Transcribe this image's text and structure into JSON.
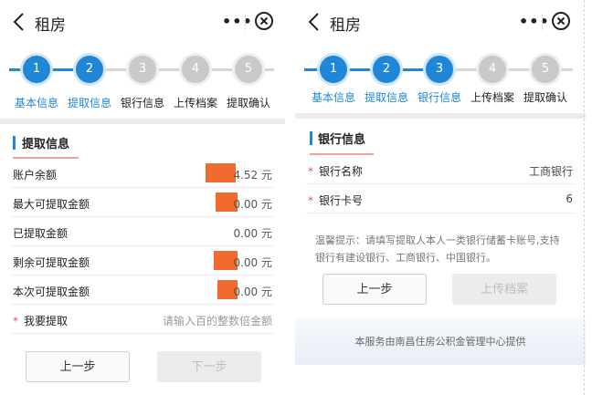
{
  "left": {
    "title": "租房",
    "more": "•••",
    "steps": [
      {
        "num": "1",
        "label": "基本信息",
        "state": "active"
      },
      {
        "num": "2",
        "label": "提取信息",
        "state": "active"
      },
      {
        "num": "3",
        "label": "银行信息",
        "state": "inactive"
      },
      {
        "num": "4",
        "label": "上传档案",
        "state": "inactive"
      },
      {
        "num": "5",
        "label": "提取确认",
        "state": "inactive"
      }
    ],
    "section_title": "提取信息",
    "rows": [
      {
        "label": "账户余额",
        "value": "4.52 元"
      },
      {
        "label": "最大可提取金额",
        "value": "0.00 元"
      },
      {
        "label": "已提取金额",
        "value": "0.00 元"
      },
      {
        "label": "剩余可提取金额",
        "value": "0.00 元"
      },
      {
        "label": "本次可提取金额",
        "value": "0.00 元"
      }
    ],
    "input_row": {
      "star": "*",
      "label": "我要提取",
      "placeholder": "请输入百的整数倍金额"
    },
    "prev_label": "上一步",
    "next_label": "下一步"
  },
  "right": {
    "title": "租房",
    "more": "•••",
    "steps": [
      {
        "num": "1",
        "label": "基本信息",
        "state": "active"
      },
      {
        "num": "2",
        "label": "提取信息",
        "state": "active"
      },
      {
        "num": "3",
        "label": "银行信息",
        "state": "active"
      },
      {
        "num": "4",
        "label": "上传档案",
        "state": "inactive"
      },
      {
        "num": "5",
        "label": "提取确认",
        "state": "inactive"
      }
    ],
    "section_title": "银行信息",
    "rows": [
      {
        "star": "*",
        "label": "银行名称",
        "value": "工商银行"
      },
      {
        "star": "*",
        "label": "银行卡号",
        "value": "6"
      }
    ],
    "hint_line1": "温馨提示：请填写提取人本人一类银行储蓄卡账号,支持",
    "hint_line2": "银行有建设银行、工商银行、中国银行。",
    "prev_label": "上一步",
    "next_label": "上传档案",
    "footer_text": "本服务由南昌住房公积金管理中心提供"
  },
  "colors": {
    "accent": "#1f86d8",
    "inactive_step": "#c9c9c9",
    "required_star": "#e05a4e",
    "redaction": "#f26a2d"
  },
  "icons": {
    "back": "chevron-left-icon",
    "close": "close-circle-icon",
    "more": "more-dots-icon"
  }
}
